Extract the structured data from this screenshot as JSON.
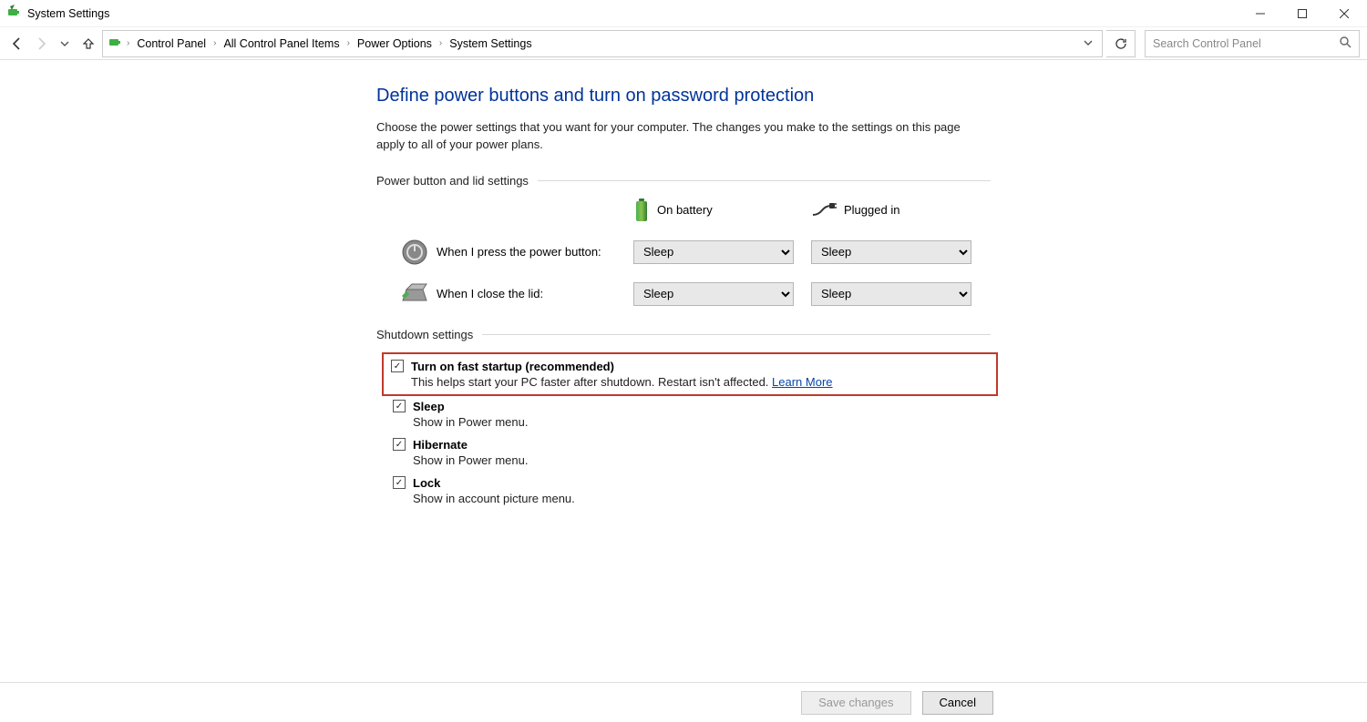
{
  "window": {
    "title": "System Settings"
  },
  "breadcrumbs": {
    "items": [
      "Control Panel",
      "All Control Panel Items",
      "Power Options",
      "System Settings"
    ]
  },
  "search": {
    "placeholder": "Search Control Panel"
  },
  "page": {
    "heading": "Define power buttons and turn on password protection",
    "description": "Choose the power settings that you want for your computer. The changes you make to the settings on this page apply to all of your power plans."
  },
  "sections": {
    "power_button_lid": "Power button and lid settings",
    "shutdown": "Shutdown settings"
  },
  "col_headers": {
    "battery": "On battery",
    "plugged": "Plugged in"
  },
  "rows": {
    "power_button": {
      "label": "When I press the power button:",
      "battery_value": "Sleep",
      "plugged_value": "Sleep"
    },
    "close_lid": {
      "label": "When I close the lid:",
      "battery_value": "Sleep",
      "plugged_value": "Sleep"
    }
  },
  "shutdown_items": {
    "fast_startup": {
      "checked": true,
      "title": "Turn on fast startup (recommended)",
      "desc": "This helps start your PC faster after shutdown. Restart isn't affected. ",
      "link": "Learn More"
    },
    "sleep": {
      "checked": true,
      "title": "Sleep",
      "desc": "Show in Power menu."
    },
    "hibernate": {
      "checked": true,
      "title": "Hibernate",
      "desc": "Show in Power menu."
    },
    "lock": {
      "checked": true,
      "title": "Lock",
      "desc": "Show in account picture menu."
    }
  },
  "buttons": {
    "save": "Save changes",
    "cancel": "Cancel"
  }
}
